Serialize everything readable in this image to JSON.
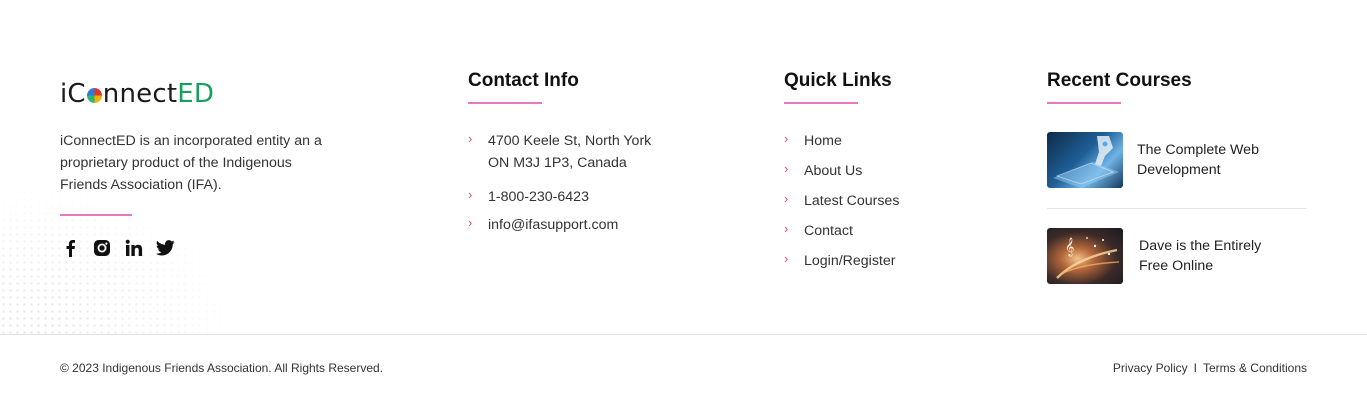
{
  "brand": {
    "logo_prefix": "iC",
    "logo_middle": "nnect",
    "logo_suffix": "ED",
    "logo_accent_color": "#17a05b",
    "about": "iConnectED is an incorporated entity an a proprietary product of the Indigenous Friends Association (IFA).",
    "socials": [
      {
        "icon": "facebook-icon"
      },
      {
        "icon": "instagram-icon"
      },
      {
        "icon": "linkedin-icon"
      },
      {
        "icon": "twitter-icon"
      }
    ]
  },
  "contact": {
    "heading": "Contact Info",
    "address_line1": "4700 Keele St, North York",
    "address_line2": "ON M3J 1P3, Canada",
    "phone": "1-800-230-6423",
    "email": "info@ifasupport.com"
  },
  "quick_links": {
    "heading": "Quick Links",
    "items": [
      {
        "label": "Home"
      },
      {
        "label": "About Us"
      },
      {
        "label": "Latest Courses"
      },
      {
        "label": "Contact"
      },
      {
        "label": "Login/Register"
      }
    ]
  },
  "recent_courses": {
    "heading": "Recent Courses",
    "items": [
      {
        "title": "The Complete Web Development"
      },
      {
        "title": "Dave is the Entirely Free Online"
      }
    ]
  },
  "footer_bottom": {
    "copyright": "© 2023 Indigenous Friends Association. All Rights Reserved.",
    "privacy_label": "Privacy Policy",
    "separator": "I",
    "terms_label": "Terms & Conditions"
  },
  "colors": {
    "accent_pink": "#e779c1",
    "chevron_pink": "#e0468f",
    "brand_green": "#17a05b"
  }
}
